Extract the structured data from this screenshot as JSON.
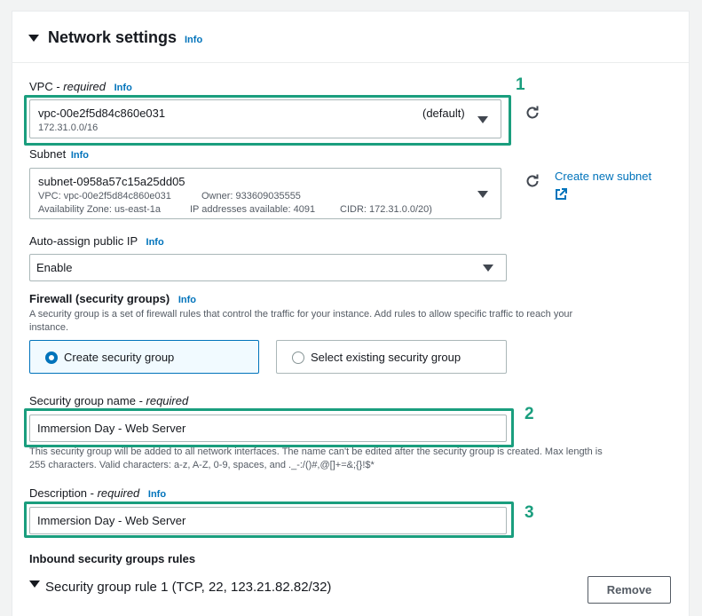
{
  "section": {
    "title": "Network settings",
    "info": "Info"
  },
  "vpc": {
    "label": "VPC - ",
    "required": "required",
    "info": "Info",
    "value": "vpc-00e2f5d84c860e031",
    "badge": "(default)",
    "cidr": "172.31.0.0/16"
  },
  "subnet": {
    "label": "Subnet",
    "info": "Info",
    "value": "subnet-0958a57c15a25dd05",
    "vpc_line": "VPC: vpc-00e2f5d84c860e031",
    "owner": "Owner: 933609035555",
    "az": "Availability Zone: us-east-1a",
    "ips": "IP addresses available: 4091",
    "cidr": "CIDR: 172.31.0.0/20)",
    "create_link": "Create new subnet"
  },
  "public_ip": {
    "label": "Auto-assign public IP",
    "info": "Info",
    "value": "Enable"
  },
  "firewall": {
    "label": "Firewall (security groups)",
    "info": "Info",
    "description_line1": "A security group is a set of firewall rules that control the traffic for your instance. Add rules to allow specific traffic to reach your",
    "description_line2": "instance.",
    "option_create": "Create security group",
    "option_existing": "Select existing security group"
  },
  "sg_name": {
    "label": "Security group name - ",
    "required": "required",
    "value": "Immersion Day - Web Server",
    "hint_line1": "This security group will be added to all network interfaces. The name can't be edited after the security group is created. Max length is",
    "hint_line2": "255 characters. Valid characters: a-z, A-Z, 0-9, spaces, and ._-:/()#,@[]+=&;{}!$*"
  },
  "description": {
    "label": "Description - ",
    "required": "required",
    "info": "Info",
    "value": "Immersion Day - Web Server"
  },
  "inbound": {
    "label": "Inbound security groups rules",
    "rule1": "Security group rule 1 (TCP, 22, 123.21.82.82/32)",
    "remove": "Remove"
  },
  "annotations": [
    "1",
    "2",
    "3"
  ],
  "colors": {
    "accent": "#0073bb",
    "highlight": "#1a9e7e"
  },
  "icons": [
    "caret-down-icon",
    "refresh-icon",
    "external-link-icon"
  ]
}
